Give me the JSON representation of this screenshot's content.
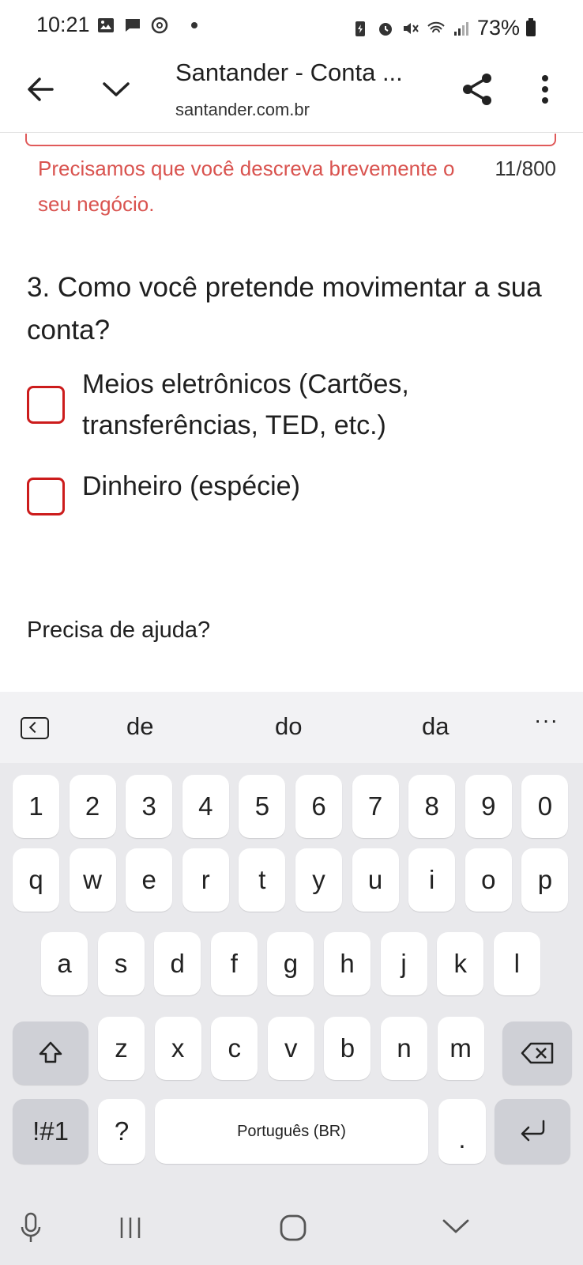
{
  "status_bar": {
    "time": "10:21",
    "battery": "73%"
  },
  "browser": {
    "title": "Santander - Conta ...",
    "url": "santander.com.br"
  },
  "form": {
    "error_message": "Precisamos que você descreva brevemente o seu negócio.",
    "char_counter": "11/800",
    "question": "3. Como você pretende movimentar a sua conta?",
    "options": [
      {
        "label": "Meios eletrônicos (Cartões, transferências, TED, etc.)",
        "checked": false
      },
      {
        "label": "Dinheiro (espécie)",
        "checked": false
      }
    ],
    "help_link": "Precisa de ajuda?",
    "accent_color": "#cc1c1c",
    "error_color": "#d9534f"
  },
  "keyboard": {
    "suggestions": [
      "de",
      "do",
      "da"
    ],
    "more": "···",
    "row_numbers": [
      "1",
      "2",
      "3",
      "4",
      "5",
      "6",
      "7",
      "8",
      "9",
      "0"
    ],
    "row_1": [
      "q",
      "w",
      "e",
      "r",
      "t",
      "y",
      "u",
      "i",
      "o",
      "p"
    ],
    "row_2": [
      "a",
      "s",
      "d",
      "f",
      "g",
      "h",
      "j",
      "k",
      "l"
    ],
    "row_3": [
      "z",
      "x",
      "c",
      "v",
      "b",
      "n",
      "m"
    ],
    "symbols_key": "!#1",
    "question_key": "?",
    "space_label": "Português (BR)",
    "period_key": "."
  }
}
